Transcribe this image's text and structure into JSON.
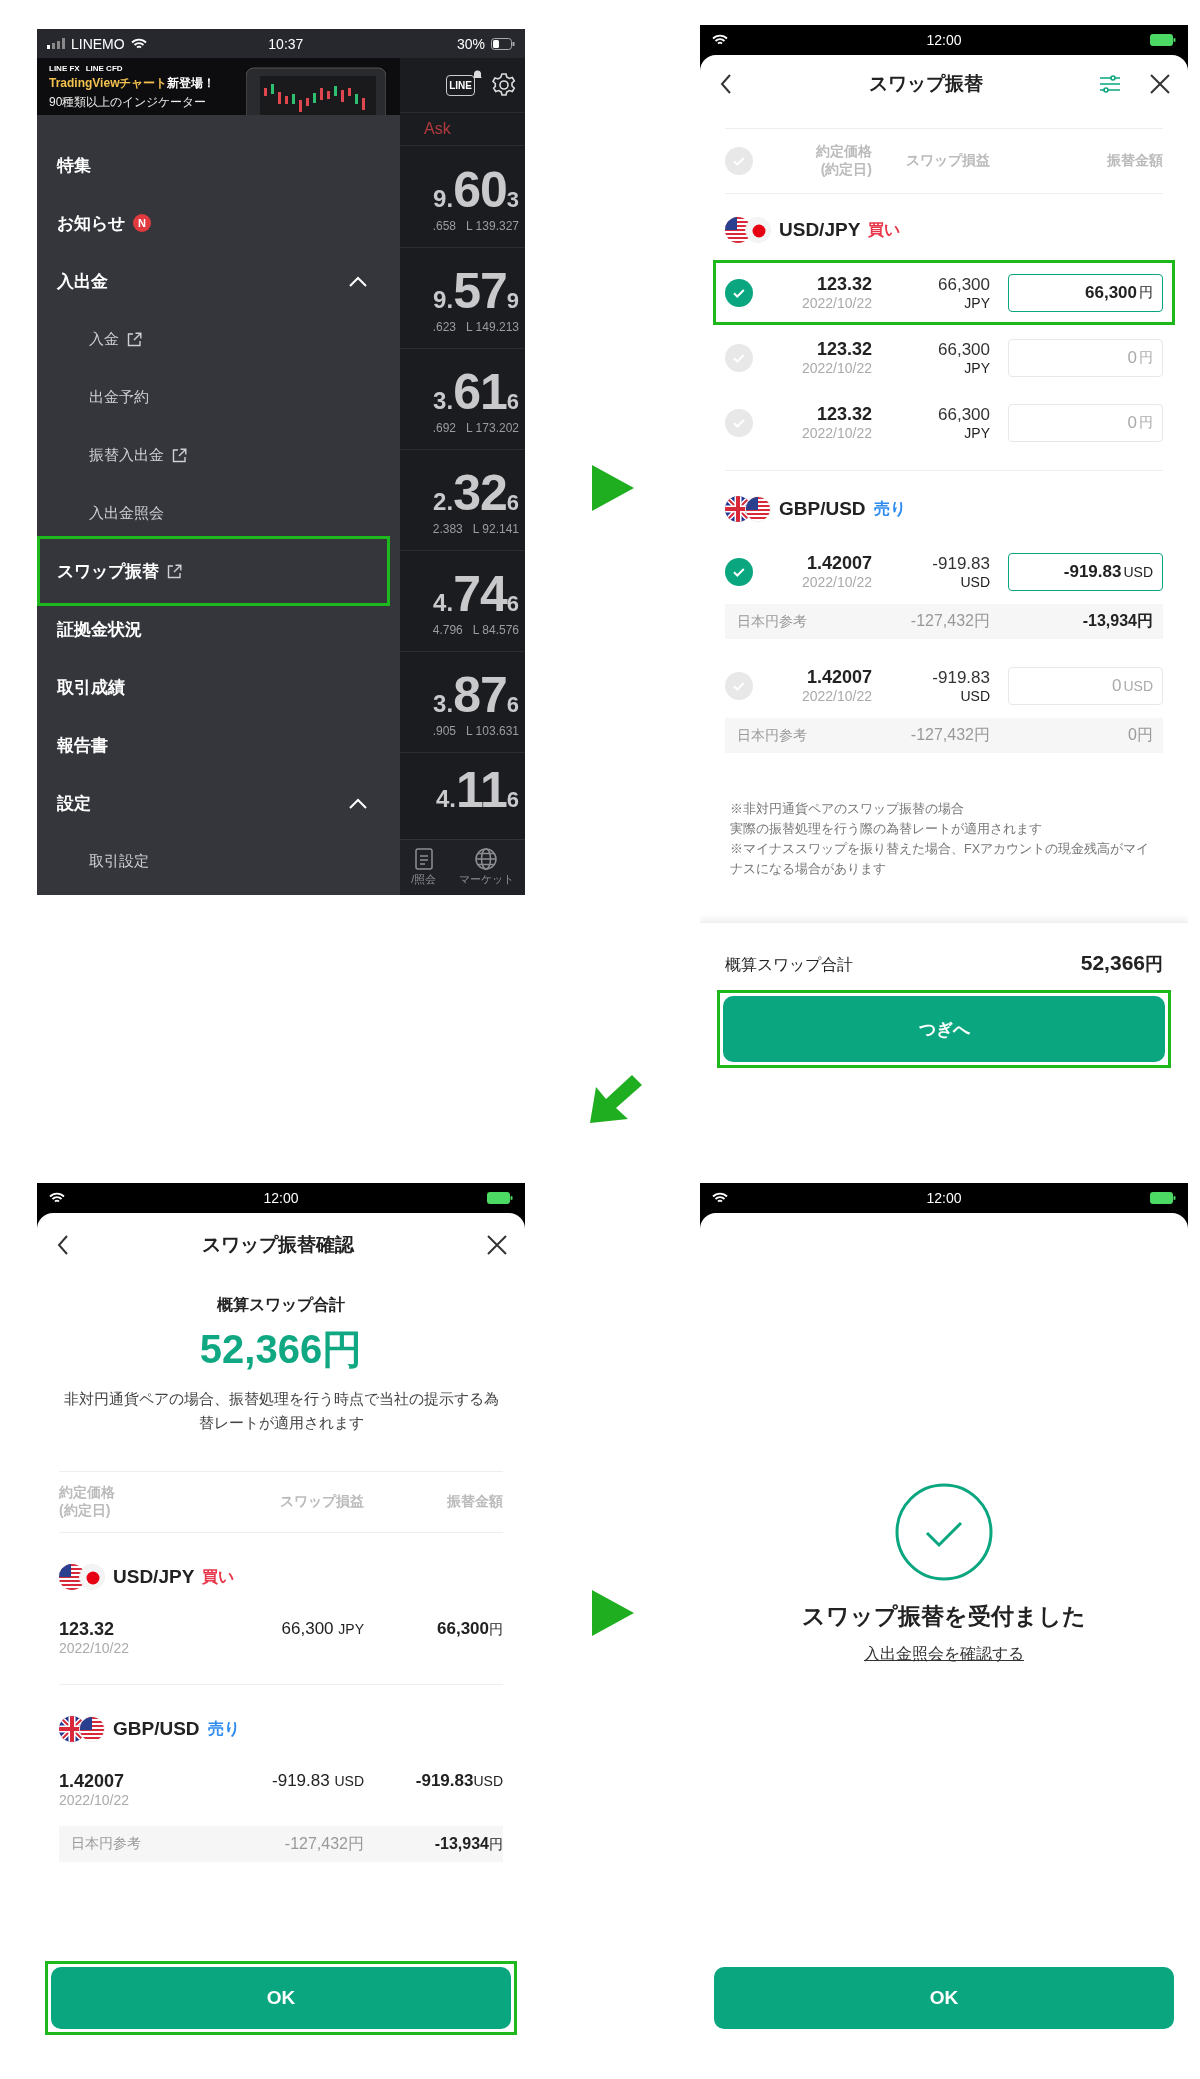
{
  "menu_screen": {
    "status_bar": {
      "carrier": "LINEMO",
      "time": "10:37",
      "battery": "30%"
    },
    "banner": {
      "brands": [
        "LINE FX",
        "LINE CFD"
      ],
      "headline": "TradingViewチャート",
      "headline_emphasis": "新登場！",
      "subtitle": "90種類以上のインジケーター"
    },
    "menu_items": [
      {
        "label": "特集",
        "kind": "link",
        "external": false,
        "highlighted": false
      },
      {
        "label": "お知らせ",
        "kind": "link",
        "external": false,
        "highlighted": false,
        "badge": "N"
      },
      {
        "label": "入出金",
        "kind": "section",
        "expanded": true,
        "highlighted": false,
        "children": [
          {
            "label": "入金",
            "external": true
          },
          {
            "label": "出金予約",
            "external": false
          },
          {
            "label": "振替入出金",
            "external": true
          },
          {
            "label": "入出金照会",
            "external": false
          }
        ]
      },
      {
        "label": "スワップ振替",
        "kind": "link",
        "external": true,
        "highlighted": true
      },
      {
        "label": "証拠金状況",
        "kind": "link",
        "external": false,
        "highlighted": false
      },
      {
        "label": "取引成績",
        "kind": "link",
        "external": false,
        "highlighted": false
      },
      {
        "label": "報告書",
        "kind": "link",
        "external": false,
        "highlighted": false
      },
      {
        "label": "設定",
        "kind": "section",
        "expanded": true,
        "highlighted": false,
        "children": [
          {
            "label": "取引設定",
            "external": false
          }
        ]
      }
    ],
    "price_panel": {
      "notify_icon_text": "LINE",
      "column_label": "Ask",
      "rows": [
        {
          "prefix": "9.",
          "big": "60",
          "small": "3",
          "high": ".658",
          "low": "L 139.327"
        },
        {
          "prefix": "9.",
          "big": "57",
          "small": "9",
          "high": ".623",
          "low": "L 149.213"
        },
        {
          "prefix": "3.",
          "big": "61",
          "small": "6",
          "high": ".692",
          "low": "L 173.202"
        },
        {
          "prefix": "2.",
          "big": "32",
          "small": "6",
          "high": "2.383",
          "low": "L 92.141"
        },
        {
          "prefix": "4.",
          "big": "74",
          "small": "6",
          "high": "4.796",
          "low": "L 84.576"
        },
        {
          "prefix": "3.",
          "big": "87",
          "small": "6",
          "high": ".905",
          "low": "L 103.631"
        },
        {
          "prefix": "4.",
          "big": "11",
          "small": "6"
        }
      ]
    },
    "tab_bar": [
      {
        "label": "/照会",
        "kind": "document"
      },
      {
        "label": "マーケット",
        "kind": "globe"
      }
    ]
  },
  "swap_screen": {
    "status_bar": {
      "time": "12:00"
    },
    "title": "スワップ振替",
    "columns": {
      "select_all_checked": false,
      "price": "約定価格",
      "price_sub": "(約定日)",
      "swap": "スワップ損益",
      "amount": "振替金額"
    },
    "pairs": [
      {
        "pair": "USD/JPY",
        "side": "買い",
        "kind": "buy",
        "flags": [
          {
            "kind": "us"
          },
          {
            "kind": "jp"
          }
        ],
        "positions": [
          {
            "checked": true,
            "highlighted": true,
            "price": "123.32",
            "date": "2022/10/22",
            "swap": "66,300",
            "swap_unit": "JPY",
            "amount": "66,300",
            "amount_unit": "円"
          },
          {
            "checked": false,
            "highlighted": false,
            "price": "123.32",
            "date": "2022/10/22",
            "swap": "66,300",
            "swap_unit": "JPY",
            "amount": "0",
            "amount_unit": "円"
          },
          {
            "checked": false,
            "highlighted": false,
            "price": "123.32",
            "date": "2022/10/22",
            "swap": "66,300",
            "swap_unit": "JPY",
            "amount": "0",
            "amount_unit": "円"
          }
        ]
      },
      {
        "pair": "GBP/USD",
        "side": "売り",
        "kind": "sell",
        "flags": [
          {
            "kind": "gb"
          },
          {
            "kind": "us"
          }
        ],
        "positions": [
          {
            "checked": true,
            "highlighted": false,
            "price": "1.42007",
            "date": "2022/10/22",
            "swap": "-919.83",
            "swap_unit": "USD",
            "amount": "-919.83",
            "amount_unit": "USD",
            "yen_ref": {
              "label": "日本円参考",
              "swap": "-127,432円",
              "amount": "-13,934円"
            }
          },
          {
            "checked": false,
            "highlighted": false,
            "price": "1.42007",
            "date": "2022/10/22",
            "swap": "-919.83",
            "swap_unit": "USD",
            "amount": "0",
            "amount_unit": "USD",
            "yen_ref": {
              "label": "日本円参考",
              "swap": "-127,432円",
              "amount": "0円"
            }
          }
        ]
      }
    ],
    "notes": [
      "※非対円通貨ペアのスワップ振替の場合",
      "実際の振替処理を行う際の為替レートが適用されます",
      "※マイナススワップを振り替えた場合、FXアカウントの現金残高がマイナスになる場合があります"
    ],
    "total": {
      "label": "概算スワップ合計",
      "value": "52,366",
      "unit": "円"
    },
    "next_button": {
      "label": "つぎへ",
      "highlighted": true
    }
  },
  "confirm_screen": {
    "status_bar": {
      "time": "12:00"
    },
    "title": "スワップ振替確認",
    "total_label": "概算スワップ合計",
    "total_value": "52,366円",
    "description": "非対円通貨ペアの場合、振替処理を行う時点で当社の提示する為替レートが適用されます",
    "columns": {
      "price": "約定価格",
      "price_sub": "(約定日)",
      "swap": "スワップ損益",
      "amount": "振替金額"
    },
    "pairs": [
      {
        "pair": "USD/JPY",
        "side": "買い",
        "kind": "buy",
        "flags": [
          {
            "kind": "us"
          },
          {
            "kind": "jp"
          }
        ],
        "positions": [
          {
            "price": "123.32",
            "date": "2022/10/22",
            "swap": "66,300",
            "swap_unit": "JPY",
            "amount": "66,300",
            "amount_unit": "円"
          }
        ]
      },
      {
        "pair": "GBP/USD",
        "side": "売り",
        "kind": "sell",
        "flags": [
          {
            "kind": "gb"
          },
          {
            "kind": "us"
          }
        ],
        "positions": [
          {
            "price": "1.42007",
            "date": "2022/10/22",
            "swap": "-919.83",
            "swap_unit": "USD",
            "amount": "-919.83",
            "amount_unit": "USD",
            "yen_ref": {
              "label": "日本円参考",
              "swap": "-127,432円",
              "amount": "-13,934",
              "amount_unit": "円"
            }
          }
        ]
      }
    ],
    "ok_button": {
      "label": "OK",
      "highlighted": true
    }
  },
  "done_screen": {
    "status_bar": {
      "time": "12:00"
    },
    "message": "スワップ振替を受付ました",
    "link": "入出金照会を確認する",
    "ok_button": {
      "label": "OK",
      "highlighted": false
    }
  },
  "arrows": [
    {
      "kind": "right"
    },
    {
      "kind": "diagonal"
    },
    {
      "kind": "right"
    }
  ]
}
